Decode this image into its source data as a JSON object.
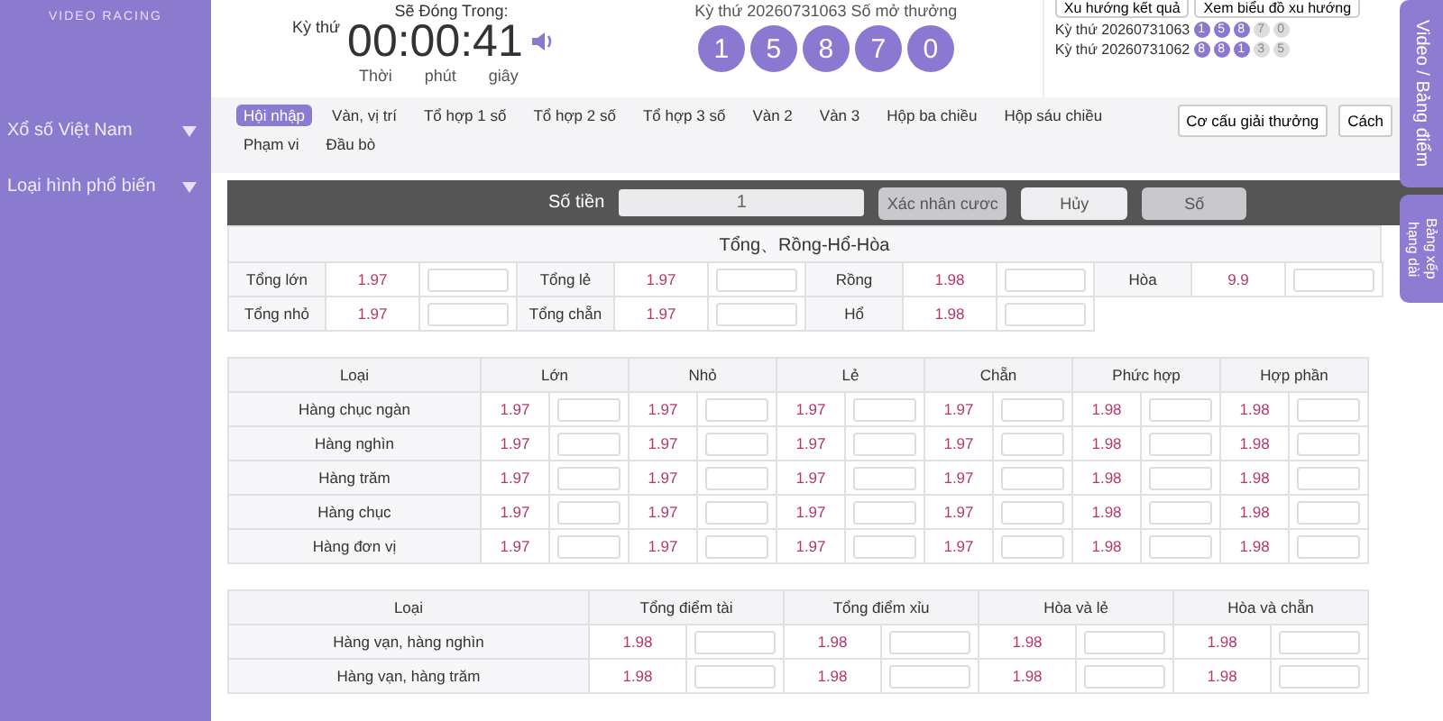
{
  "sidebar": {
    "subtitle": "VIDEO RACING",
    "menu": [
      {
        "label": "Xổ số Việt Nam"
      },
      {
        "label": "Loại hình phổ biến"
      }
    ]
  },
  "header": {
    "period_label": "Kỳ thứ",
    "closing_label": "Sẽ Đóng Trong:",
    "timer": "00:00:41",
    "timer_units": [
      "Thời",
      "phút",
      "giây"
    ],
    "draw_label": "Kỳ thứ 20260731063   Số mở thưởng",
    "draw_balls": [
      "1",
      "5",
      "8",
      "7",
      "0"
    ],
    "buttons": [
      "Xu hướng kết quả",
      "Xem biểu đồ xu hướng"
    ],
    "history": [
      {
        "label": "Kỳ thứ 20260731063",
        "balls": [
          {
            "n": "1",
            "highlighted": true
          },
          {
            "n": "5",
            "highlighted": true
          },
          {
            "n": "8",
            "highlighted": true
          },
          {
            "n": "7",
            "highlighted": false
          },
          {
            "n": "0",
            "highlighted": false
          }
        ]
      },
      {
        "label": "Kỳ thứ 20260731062",
        "balls": [
          {
            "n": "8",
            "highlighted": true
          },
          {
            "n": "8",
            "highlighted": true
          },
          {
            "n": "1",
            "highlighted": true
          },
          {
            "n": "3",
            "highlighted": false
          },
          {
            "n": "5",
            "highlighted": false
          }
        ]
      }
    ]
  },
  "tab_rows": [
    [
      {
        "label": "Hội nhập",
        "selected": true
      },
      {
        "label": "Vàn, vị trí",
        "selected": false
      },
      {
        "label": "Tổ hợp 1 số",
        "selected": false
      },
      {
        "label": "Tổ hợp 2 số",
        "selected": false
      },
      {
        "label": "Tổ hợp 3 số",
        "selected": false
      },
      {
        "label": "Vàn 2",
        "selected": false
      },
      {
        "label": "Vàn 3",
        "selected": false
      },
      {
        "label": "Hộp ba chiều",
        "selected": false
      },
      {
        "label": "Hộp sáu chiều",
        "selected": false
      }
    ],
    [
      {
        "label": "Phạm vi",
        "selected": false
      },
      {
        "label": "Đầu bò",
        "selected": false
      }
    ]
  ],
  "tab_buttons": [
    "Cơ cấu giải thưởng",
    "Cách"
  ],
  "bet_bar": {
    "amount_label": "Số tiền",
    "amount": "1",
    "buttons": [
      "Xác nhân cươc",
      "Hủy",
      "Số"
    ]
  },
  "section": {
    "title": "Tổng、Rồng-Hổ-Hòa",
    "rows": [
      [
        {
          "label": "Tổng lớn",
          "odds": "1.97"
        },
        {
          "label": "Tổng lẻ",
          "odds": "1.97"
        },
        {
          "label": "Rồng",
          "odds": "1.98"
        },
        {
          "label": "Hòa",
          "odds": "9.9"
        }
      ],
      [
        {
          "label": "Tổng nhỏ",
          "odds": "1.97"
        },
        {
          "label": "Tổng chẵn",
          "odds": "1.97"
        },
        {
          "label": "Hổ",
          "odds": "1.98"
        }
      ]
    ]
  },
  "digit_table": {
    "columns": [
      "Loại",
      "Lớn",
      "Nhỏ",
      "Lẻ",
      "Chẵn",
      "Phức hợp",
      "Hợp phần"
    ],
    "rows": [
      {
        "label": "Hàng chục ngàn",
        "odds": [
          "1.97",
          "1.97",
          "1.97",
          "1.97",
          "1.98",
          "1.98"
        ]
      },
      {
        "label": "Hàng nghìn",
        "odds": [
          "1.97",
          "1.97",
          "1.97",
          "1.97",
          "1.98",
          "1.98"
        ]
      },
      {
        "label": "Hàng trăm",
        "odds": [
          "1.97",
          "1.97",
          "1.97",
          "1.97",
          "1.98",
          "1.98"
        ]
      },
      {
        "label": "Hàng chục",
        "odds": [
          "1.97",
          "1.97",
          "1.97",
          "1.97",
          "1.98",
          "1.98"
        ]
      },
      {
        "label": "Hàng đơn vị",
        "odds": [
          "1.97",
          "1.97",
          "1.97",
          "1.97",
          "1.98",
          "1.98"
        ]
      }
    ]
  },
  "pair_table": {
    "columns": [
      "Loại",
      "Tổng điểm tài",
      "Tổng điểm xỉu",
      "Hòa và lẻ",
      "Hòa và chẵn"
    ],
    "rows": [
      {
        "label": "Hàng vạn, hàng nghìn",
        "odds": [
          "1.98",
          "1.98",
          "1.98",
          "1.98"
        ]
      },
      {
        "label": "Hàng vạn, hàng trăm",
        "odds": [
          "1.98",
          "1.98",
          "1.98",
          "1.98"
        ]
      }
    ]
  },
  "side_tabs": [
    "Video / Bảng điểm",
    "Bảng xếp hạng dài"
  ]
}
